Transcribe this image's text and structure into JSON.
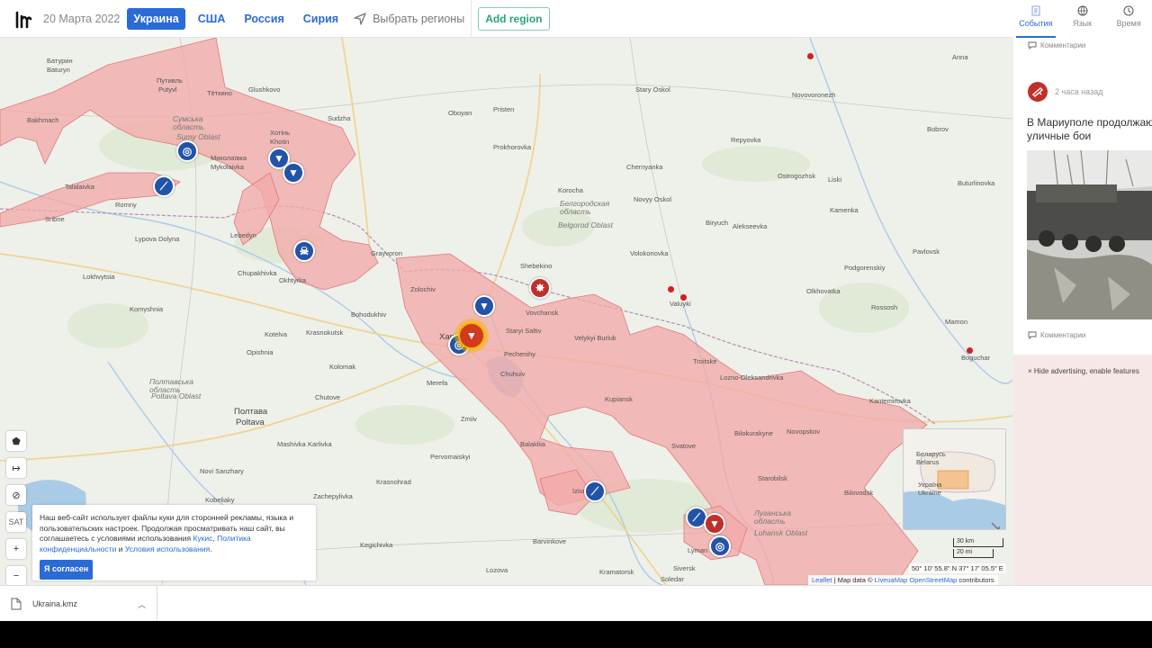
{
  "header": {
    "date": "20 Марта 2022",
    "nav": [
      "Украина",
      "США",
      "Россия",
      "Сирия"
    ],
    "active_nav": "Украина",
    "region_select": "Выбрать регионы",
    "add_region": "Add region"
  },
  "right_tabs": [
    {
      "label": "События",
      "icon": "events-icon"
    },
    {
      "label": "Язык",
      "icon": "globe-icon"
    },
    {
      "label": "Время",
      "icon": "clock-icon"
    }
  ],
  "sidebar": {
    "comment_label_top": "Комментарии",
    "event_time": "2 часа назад",
    "event_title_line1": "В Мариуполе продолжаются",
    "event_title_line2": "уличные бои",
    "comment_label_bottom": "Комментарии",
    "ads_link": "× Hide advertising, enable features"
  },
  "map": {
    "places": [
      {
        "id": "kharkiv",
        "label": "Харків"
      },
      {
        "id": "poltava",
        "label": "Poltava"
      },
      {
        "id": "poltava_ua",
        "label": "Полтава"
      },
      {
        "id": "sumy_oblast_ua",
        "label": "Сумська область"
      },
      {
        "id": "sumy_oblast",
        "label": "Sumy Oblast"
      },
      {
        "id": "belgorod_oblast_ua",
        "label": "Белгородская область"
      },
      {
        "id": "belgorod_oblast",
        "label": "Belgorod Oblast"
      },
      {
        "id": "poltava_oblast_ua",
        "label": "Полтавська область"
      },
      {
        "id": "poltava_oblast",
        "label": "Poltava Oblast"
      },
      {
        "id": "luhansk_oblast_ua",
        "label": "Луганська область"
      },
      {
        "id": "luhansk_oblast",
        "label": "Luhansk Oblast"
      },
      {
        "id": "putyvl_ua",
        "label": "Путивль"
      },
      {
        "id": "putyvl",
        "label": "Putyvl"
      },
      {
        "id": "baturyn_ua",
        "label": "Батурин"
      },
      {
        "id": "baturyn",
        "label": "Baturyn"
      },
      {
        "id": "bakhmach",
        "label": "Bakhmach"
      },
      {
        "id": "teikino",
        "label": "Тёткино"
      },
      {
        "id": "glushkovo",
        "label": "Glushkovo"
      },
      {
        "id": "khotin",
        "label": "Хотінь"
      },
      {
        "id": "khotin_lat",
        "label": "Khotin"
      },
      {
        "id": "mykolaivka",
        "label": "Миколаївка"
      },
      {
        "id": "mykolaivka_lat",
        "label": "Mykolaivka"
      },
      {
        "id": "romny",
        "label": "Romny"
      },
      {
        "id": "sribne",
        "label": "Sribne"
      },
      {
        "id": "talalaivka",
        "label": "Talalaivka"
      },
      {
        "id": "lypova_dolyna",
        "label": "Lypova Dolyna"
      },
      {
        "id": "lebedyn",
        "label": "Lebedyn"
      },
      {
        "id": "okhtyrka",
        "label": "Okhtyrka"
      },
      {
        "id": "chupakhivka",
        "label": "Chupakhivka"
      },
      {
        "id": "lokhvytsia",
        "label": "Lokhvytsia"
      },
      {
        "id": "komyshnia",
        "label": "Komyshnia"
      },
      {
        "id": "sudzha",
        "label": "Sudzha"
      },
      {
        "id": "oboyan",
        "label": "Oboyan"
      },
      {
        "id": "pristen",
        "label": "Pristen"
      },
      {
        "id": "prokhorovka",
        "label": "Prokhorovka"
      },
      {
        "id": "korocha",
        "label": "Korocha"
      },
      {
        "id": "stary_oskol",
        "label": "Stary Oskol"
      },
      {
        "id": "novy_oskol",
        "label": "Novyy Oskol"
      },
      {
        "id": "chernyanka",
        "label": "Chernyanka"
      },
      {
        "id": "biryuch",
        "label": "Biryuch"
      },
      {
        "id": "alekseevka",
        "label": "Alekseevka"
      },
      {
        "id": "volokonovka",
        "label": "Volokonovka"
      },
      {
        "id": "valuyki",
        "label": "Valuyki"
      },
      {
        "id": "shebekino",
        "label": "Shebekino"
      },
      {
        "id": "grayvoron",
        "label": "Grayvoron"
      },
      {
        "id": "zolochiv",
        "label": "Zolochiv"
      },
      {
        "id": "bohodukhiv",
        "label": "Bohodukhiv"
      },
      {
        "id": "krasnokutsk",
        "label": "Krasnokutsk"
      },
      {
        "id": "kolomak",
        "label": "Kolomak"
      },
      {
        "id": "chutove",
        "label": "Chutove"
      },
      {
        "id": "kotelva",
        "label": "Kotelva"
      },
      {
        "id": "opishnia",
        "label": "Opishnia"
      },
      {
        "id": "karlivka",
        "label": "Karlivka"
      },
      {
        "id": "mashivka",
        "label": "Mashivka"
      },
      {
        "id": "novi_sanzhary",
        "label": "Novi Sanzhary"
      },
      {
        "id": "kobeliaky",
        "label": "Kobeliaky"
      },
      {
        "id": "zachepylivka",
        "label": "Zachepylivka"
      },
      {
        "id": "balakliia",
        "label": "Balakliia"
      },
      {
        "id": "chuhuiv",
        "label": "Chuhuiv"
      },
      {
        "id": "izium",
        "label": "Izium"
      },
      {
        "id": "barvinkove",
        "label": "Barvinkove"
      },
      {
        "id": "lozova",
        "label": "Lozova"
      },
      {
        "id": "kupiansk",
        "label": "Kupiansk"
      },
      {
        "id": "svatove",
        "label": "Svatove"
      },
      {
        "id": "starobilsk",
        "label": "Starobilsk"
      },
      {
        "id": "rossosh",
        "label": "Rossosh"
      },
      {
        "id": "kantemirovka",
        "label": "Kantemirovka"
      },
      {
        "id": "bilovodsk",
        "label": "Bilovodsk"
      },
      {
        "id": "novopskov",
        "label": "Novopskov"
      },
      {
        "id": "bilokurakyne",
        "label": "Bilokurakyne"
      },
      {
        "id": "lozno_oleksandrivka",
        "label": "Lozno-Oleksandrivka"
      },
      {
        "id": "troitske",
        "label": "Troitske"
      },
      {
        "id": "vovchansk",
        "label": "Vovchansk"
      },
      {
        "id": "velykyi_burluk",
        "label": "Velykyi Burluk"
      },
      {
        "id": "staryi_saltiv",
        "label": "Staryi Saltiv"
      },
      {
        "id": "pechenihy",
        "label": "Pechenihy"
      },
      {
        "id": "lyman",
        "label": "Lyman"
      },
      {
        "id": "siversk",
        "label": "Siversk"
      },
      {
        "id": "kramatorsk",
        "label": "Kramatorsk"
      },
      {
        "id": "soledar",
        "label": "Soledar"
      },
      {
        "id": "zmiiv",
        "label": "Zmiiv"
      },
      {
        "id": "merefa",
        "label": "Merefa"
      },
      {
        "id": "krasnohrad",
        "label": "Krasnohrad"
      },
      {
        "id": "kegichivka",
        "label": "Kegichivka"
      },
      {
        "id": "pervomaiskyi",
        "label": "Pervomaiskyi"
      },
      {
        "id": "bogucharu",
        "label": "Boguchar"
      },
      {
        "id": "ostrogozhsk",
        "label": "Ostrogozhsk"
      },
      {
        "id": "liski",
        "label": "Liski"
      },
      {
        "id": "novovoronezh",
        "label": "Novovoronezh"
      },
      {
        "id": "olkhovatka",
        "label": "Olkhovatka"
      },
      {
        "id": "podgorenskiy",
        "label": "Podgorenskiy"
      },
      {
        "id": "kamenka",
        "label": "Kamenka"
      },
      {
        "id": "repyovka",
        "label": "Repyovka"
      },
      {
        "id": "mironov",
        "label": "Mamon"
      },
      {
        "id": "pavlovsk",
        "label": "Pavlovsk"
      },
      {
        "id": "buturlinovka",
        "label": "Buturlinovka"
      },
      {
        "id": "bobrov",
        "label": "Bobrov"
      },
      {
        "id": "anna",
        "label": "Anna"
      }
    ],
    "markers_legend": "events",
    "minimap": {
      "belarus": "Belarus",
      "belarus_local": "Беларусь",
      "ukraine": "Україна",
      "ukraine_lat": "Ukraine"
    },
    "scale_km": "30 km",
    "scale_mi": "20 mi",
    "coords": "50° 10' 55.8\" N 37° 17' 05.5\" E",
    "attrib_leaflet": "Leaflet",
    "attrib_rest": " | Map data © ",
    "attrib_links": "LiveuaMap OpenStreetMap",
    "attrib_tail": " contributors"
  },
  "tools": {
    "sat": "SAT",
    "zoom_in": "+",
    "zoom_out": "−"
  },
  "cookie": {
    "text_part1": "Наш веб-сайт использует файлы куки для сторонней рекламы, языка и пользовательских настроек. Продолжая просматривать наш сайт, вы соглашаетесь с условиями использования ",
    "link_cookies": "Кукис",
    "comma": ", ",
    "link_privacy": "Политика конфиденциальности",
    "and": " и ",
    "link_terms": "Условия использования",
    "dot": ".",
    "button": "Я согласен"
  },
  "download": {
    "filename": "Ukraina.kmz"
  },
  "colors": {
    "accent": "#2a6bd6",
    "occupied": "#f2a9a9",
    "marker_blue": "#2153a8",
    "marker_red": "#c22f2a",
    "add_region": "#2aa57a"
  }
}
